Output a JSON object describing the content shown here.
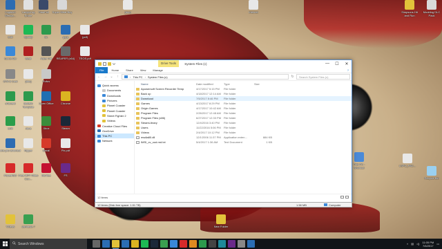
{
  "desktop_icons": [
    {
      "label": "Logitech Webca...",
      "color": "#2d6cb2"
    },
    {
      "label": "Langmi.ng Entire",
      "color": "#e1e1e1"
    },
    {
      "label": "TitanFall",
      "color": "#3a4a6a"
    },
    {
      "label": "Super Meat Boy",
      "color": "#d8d8d8"
    },
    {
      "label": "(doc)",
      "color": "#e8e8e8"
    },
    {
      "label": "Internet",
      "color": "#e8e8e8"
    },
    {
      "label": "Simpsons Hit and Run",
      "color": "#e2c23a"
    },
    {
      "label": "Modding DLC Pack",
      "color": "#d9d9d9"
    },
    {
      "label": "Edit",
      "color": "#e8e8e8"
    },
    {
      "label": "Spotify",
      "color": "#1db954"
    },
    {
      "label": "Dr.",
      "color": "#2d9a4d"
    },
    {
      "label": "(ppt)",
      "color": "#2b6db3"
    },
    {
      "label": "(pdf)",
      "color": "#e8e8e8"
    },
    {
      "label": "Sonic Adv",
      "color": "#3a88d8"
    },
    {
      "label": "Beat",
      "color": "#b02020"
    },
    {
      "label": "Aster Pat",
      "color": "#555"
    },
    {
      "label": "REAPER (x64)",
      "color": "#6a6a6a"
    },
    {
      "label": "TEOS.pdf",
      "color": "#e8e8e8"
    },
    {
      "label": "GTA 5 Cost",
      "color": "#888"
    },
    {
      "label": "(doc)",
      "color": "#e8e8e8"
    },
    {
      "label": "Rufus",
      "color": "#c8c8c8"
    },
    {
      "label": "uTorrent",
      "color": "#2d9a4d"
    },
    {
      "label": "Bulletin Template",
      "color": "#2d9a4d"
    },
    {
      "label": "Open Office",
      "color": "#1f6fb2"
    },
    {
      "label": "Chrome",
      "color": "#dbb321"
    },
    {
      "label": "Link",
      "color": "#2a9d4a"
    },
    {
      "label": "Java",
      "color": "#e8e8e8"
    },
    {
      "label": "Xbox",
      "color": "#3b8d3b"
    },
    {
      "label": "Steam",
      "color": "#1b2838"
    },
    {
      "label": "obs-pro tshortcut",
      "color": "#2d6cb2"
    },
    {
      "label": "Ripper",
      "color": "#e8e8e8"
    },
    {
      "label": "Gmail",
      "color": "#d63a2a"
    },
    {
      "label": "Pix.pdf",
      "color": "#e8e8e8"
    },
    {
      "label": "PowerISO",
      "color": "#d62a2a"
    },
    {
      "label": "Free MP4 Video Con...",
      "color": "#d62a2a"
    },
    {
      "label": "McAfee",
      "color": "#c41230"
    },
    {
      "label": "FS",
      "color": "#6a2a8a"
    },
    {
      "label": "Videos",
      "color": "#e2c23a"
    },
    {
      "label": "camtasia 7",
      "color": "#3aa050"
    },
    {
      "label": "Recycle Bin",
      "color": "#9ad0f0"
    },
    {
      "label": "This PC - Shortcut",
      "color": "#4a8ad8"
    },
    {
      "label": "LSPD_PAC...",
      "color": "#e8e8e8"
    },
    {
      "label": "New Folder",
      "color": "#e2c23a"
    }
  ],
  "window": {
    "title": "System Files (c)",
    "context_tab": "Drive Tools",
    "controls": {
      "minimize": "—",
      "maximize": "☐",
      "close": "✕"
    },
    "ribbon_tabs": [
      "File",
      "Home",
      "Share",
      "View",
      "Manage"
    ],
    "help": "?",
    "address": {
      "segments": [
        "This PC",
        "System Files (c)"
      ]
    },
    "search_placeholder": "Search System Files (c)",
    "nav_pane": [
      {
        "label": "Quick access",
        "color": "#3a88d8",
        "indent": 0
      },
      {
        "label": "Documents",
        "color": "#c8c8c8",
        "indent": 1
      },
      {
        "label": "Downloads",
        "color": "#3a88d8",
        "indent": 1
      },
      {
        "label": "Pictures",
        "color": "#3a88d8",
        "indent": 1
      },
      {
        "label": "Planet Coaster",
        "color": "#e2c23a",
        "indent": 1
      },
      {
        "label": "Planet Coaster",
        "color": "#e2c23a",
        "indent": 1
      },
      {
        "label": "Street Fighter 2",
        "color": "#e2c23a",
        "indent": 1
      },
      {
        "label": "Videos",
        "color": "#e2c23a",
        "indent": 1
      },
      {
        "label": "Creative Cloud Files",
        "color": "#d63a2a",
        "indent": 0
      },
      {
        "label": "OneDrive",
        "color": "#2b6db3",
        "indent": 0
      },
      {
        "label": "This PC",
        "color": "#3a88d8",
        "indent": 0,
        "selected": true
      },
      {
        "label": "Network",
        "color": "#3a88d8",
        "indent": 0
      }
    ],
    "columns": [
      "Name",
      "Date modified",
      "Type",
      "Size"
    ],
    "files": [
      {
        "name": "Apowersoft Screen Recorder Temp",
        "date": "4/17/2017 5:15 PM",
        "type": "File folder",
        "size": "",
        "icon": "folder"
      },
      {
        "name": "Back up",
        "date": "4/18/2017 12:14 AM",
        "type": "File folder",
        "size": "",
        "icon": "folder"
      },
      {
        "name": "Download",
        "date": "7/5/2017 8:46 PM",
        "type": "File folder",
        "size": "",
        "icon": "folder",
        "highlight": true
      },
      {
        "name": "Games",
        "date": "4/13/2017 8:29 PM",
        "type": "File folder",
        "size": "",
        "icon": "folder"
      },
      {
        "name": "Origin Games",
        "date": "4/17/2017 10:42 AM",
        "type": "File folder",
        "size": "",
        "icon": "folder"
      },
      {
        "name": "Program Files",
        "date": "2/26/2017 12:48 AM",
        "type": "File folder",
        "size": "",
        "icon": "folder"
      },
      {
        "name": "Program Files (x86)",
        "date": "6/27/2017 12:33 PM",
        "type": "File folder",
        "size": "",
        "icon": "folder"
      },
      {
        "name": "SteamLibrary",
        "date": "12/4/2016 3:40 PM",
        "type": "File folder",
        "size": "",
        "icon": "folder"
      },
      {
        "name": "Users",
        "date": "11/22/2016 5:06 PM",
        "type": "File folder",
        "size": "",
        "icon": "folder"
      },
      {
        "name": "Videos",
        "date": "2/4/2017 10:12 PM",
        "type": "File folder",
        "size": "",
        "icon": "folder"
      },
      {
        "name": "msdia80.dll",
        "date": "12/1/2006 11:37 PM",
        "type": "Application exten...",
        "size": "884 KB",
        "icon": "file"
      },
      {
        "name": "IMSI_cv_ood.rnd.txt",
        "date": "5/4/2017 1:36 AM",
        "type": "Text Document",
        "size": "1 KB",
        "icon": "file"
      }
    ],
    "status": "12 items",
    "bottom": {
      "left": "12 items (Disk free space: 1.51 TB)",
      "size": "1.58 MB",
      "location": "Computer"
    }
  },
  "taskbar": {
    "search_placeholder": "Search Windows",
    "apps": [
      {
        "name": "task-view",
        "color": "#666"
      },
      {
        "name": "edge",
        "color": "#2b6db3"
      },
      {
        "name": "file-explorer",
        "color": "#e2c23a",
        "active": true
      },
      {
        "name": "store",
        "color": "#2b6db3"
      },
      {
        "name": "chrome",
        "color": "#dbb321"
      },
      {
        "name": "spotify",
        "color": "#1db954"
      },
      {
        "name": "steam",
        "color": "#1b2838"
      },
      {
        "name": "app-green",
        "color": "#3aa050"
      },
      {
        "name": "app-blue",
        "color": "#3a88d8"
      },
      {
        "name": "app-red",
        "color": "#d62a2a"
      },
      {
        "name": "app-orange",
        "color": "#e08a20"
      },
      {
        "name": "app-green2",
        "color": "#2d9a4d"
      },
      {
        "name": "app-dark",
        "color": "#444"
      },
      {
        "name": "app-teal",
        "color": "#1f8a9a"
      },
      {
        "name": "app-purple",
        "color": "#6a2a8a"
      },
      {
        "name": "app-gray",
        "color": "#888"
      },
      {
        "name": "app-blue2",
        "color": "#2b6db3"
      }
    ],
    "time": "11:05 PM",
    "date": "7/6/2017"
  }
}
